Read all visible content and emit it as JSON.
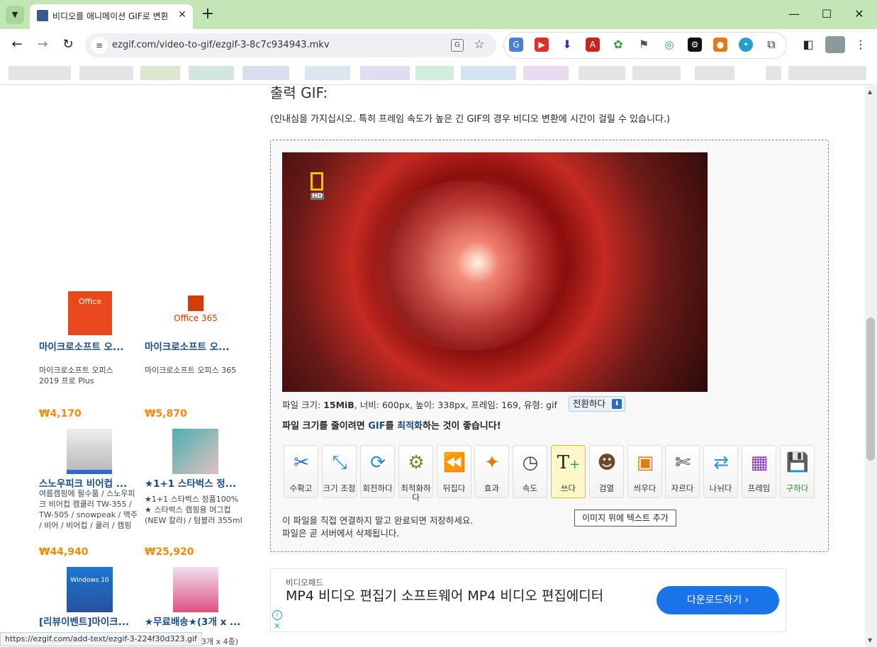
{
  "browser": {
    "tab_title": "비디오를 애니메이션 GIF로 변환",
    "address": "ezgif.com/video-to-gif/ezgif-3-8c7c934943.mkv",
    "status_url": "https://ezgif.com/add-text/ezgif-3-224f30d323.gif"
  },
  "main": {
    "heading": "출력 GIF:",
    "notice": "(인내심을 가지십시오. 특히 프레임 속도가 높은 긴 GIF의 경우 비디오 변환에 시간이 걸릴 수 있습니다.)",
    "info": {
      "size_label": "파일 크기: ",
      "size_value": "15MiB",
      "rest": ", 너비: 600px, 높이: 338px, 프레임: 169, 유형: gif",
      "convert_button": "전환하다"
    },
    "optimize": {
      "pre": "파일 크기를 줄이려면 ",
      "gif": "GIF",
      "mid": "를 ",
      "link": "최적화",
      "post": "하는 것이 좋습니다!"
    },
    "video_badge": "HD",
    "tools": [
      {
        "label": "수확고",
        "icon": "crop"
      },
      {
        "label": "크기 조정",
        "icon": "resize"
      },
      {
        "label": "회전하다",
        "icon": "rotate"
      },
      {
        "label": "최적화하다",
        "icon": "optimize"
      },
      {
        "label": "뒤집다",
        "icon": "reverse"
      },
      {
        "label": "효과",
        "icon": "effects"
      },
      {
        "label": "속도",
        "icon": "speed"
      },
      {
        "label": "쓰다",
        "icon": "write"
      },
      {
        "label": "검열",
        "icon": "censor"
      },
      {
        "label": "씌우다",
        "icon": "overlay"
      },
      {
        "label": "자르다",
        "icon": "cut"
      },
      {
        "label": "나뉘다",
        "icon": "split"
      },
      {
        "label": "프레임",
        "icon": "frames"
      },
      {
        "label": "구하다",
        "icon": "save"
      }
    ],
    "tooltip": "이미지 위에 텍스트 추가",
    "save_note_1": "이 파일을 직접 연결하지 말고 완료되면 저장하세요.",
    "save_note_2": "파일은 곧 서버에서 삭제됩니다."
  },
  "bottom_ad": {
    "source": "비디오패드",
    "title": "MP4 비디오 편집기 소프트웨어 MP4 비디오 편집에디터",
    "button": "다운로드하기"
  },
  "sidebar_ads": [
    {
      "title": "마이크로소프트 오...",
      "desc": "마이크로소프트 오피스 2019 프로 Plus",
      "price": "₩4,170",
      "thumb": "Office"
    },
    {
      "title": "마이크로소프트 오...",
      "desc": "마이크로소프트 오피스 365",
      "price": "₩5,870",
      "thumb": "Office 365"
    },
    {
      "title": "스노우피크 비어컵 ...",
      "desc": "여름캠핑에 필수품 / 스노우피크 비어컵 캠쿨러 TW-355 / TW-505 / snowpeak / 맥주 / 비어 / 비어컵 / 쿨러 / 캠핑",
      "price": "₩44,940",
      "thumb": ""
    },
    {
      "title": "★1+1 스타벅스 정...",
      "desc": "★1+1 스타벅스 정품100% ★ 스타벅스 캠핑용 머그컵 (NEW 칼라) / 텀블러 355ml",
      "price": "₩25,920",
      "thumb": ""
    },
    {
      "title": "[리뷰이벤트]마이크...",
      "desc": "",
      "price": "",
      "thumb": "Windows 10"
    },
    {
      "title": "★무료배송★(3개 x ...",
      "desc": "3개 x 4종)",
      "price": "",
      "thumb": ""
    }
  ]
}
